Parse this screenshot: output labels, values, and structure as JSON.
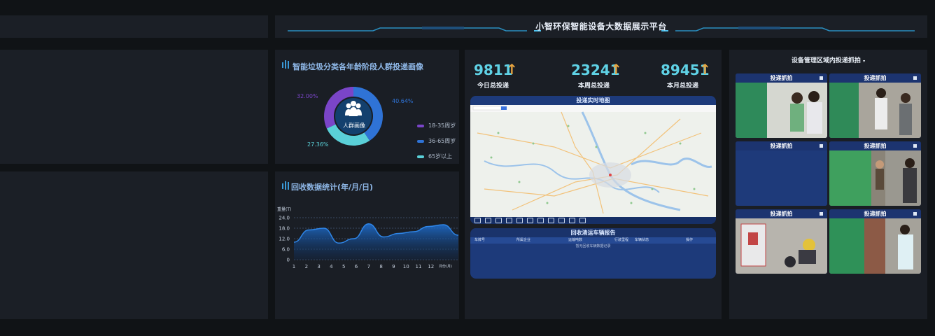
{
  "header": {
    "title": "小智环保智能设备大数据展示平台"
  },
  "donut": {
    "title": "智能垃圾分类各年龄阶段人群投递画像",
    "center_label": "人群画像",
    "segments": [
      {
        "label": "18-35周岁",
        "percent": "32.00%",
        "color": "#7a45c8"
      },
      {
        "label": "36-65周岁",
        "percent": "40.64%",
        "color": "#2f73d6"
      },
      {
        "label": "65岁以上",
        "percent": "27.36%",
        "color": "#5ad0d8"
      }
    ]
  },
  "recycle": {
    "title": "回收数据统计(年/月/日)",
    "y_unit": "重量(T)",
    "x_unit": "月份(月)",
    "y_ticks": [
      "24.0",
      "18.0",
      "12.0",
      "6.0",
      "0"
    ],
    "x_ticks": [
      "1",
      "2",
      "3",
      "4",
      "5",
      "6",
      "7",
      "8",
      "9",
      "10",
      "11",
      "12"
    ]
  },
  "chart_data": {
    "type": "area",
    "x": [
      1,
      2,
      3,
      4,
      5,
      6,
      7,
      8,
      9,
      10,
      11,
      12
    ],
    "values": [
      10,
      17,
      18,
      9.5,
      12,
      20.5,
      13,
      15,
      16,
      19,
      20,
      14
    ],
    "ylabel": "重量(T)",
    "xlabel": "月份(月)",
    "ylim": [
      0,
      24
    ],
    "grid": true
  },
  "stats": [
    {
      "value": "9811",
      "label": "今日总投递"
    },
    {
      "value": "23241",
      "label": "本周总投递"
    },
    {
      "value": "89451",
      "label": "本月总投递"
    }
  ],
  "map": {
    "title": "投递实时地图"
  },
  "report": {
    "title": "回收清运车辆报告",
    "columns": [
      "车牌号",
      "所属企业",
      "运输吨数",
      "行驶里程",
      "车辆状态",
      "操作"
    ],
    "empty_text": "暂无回收车辆数据记录"
  },
  "cameras": {
    "title": "设备管理区域内投递抓拍",
    "tile_label": "投递抓拍"
  }
}
